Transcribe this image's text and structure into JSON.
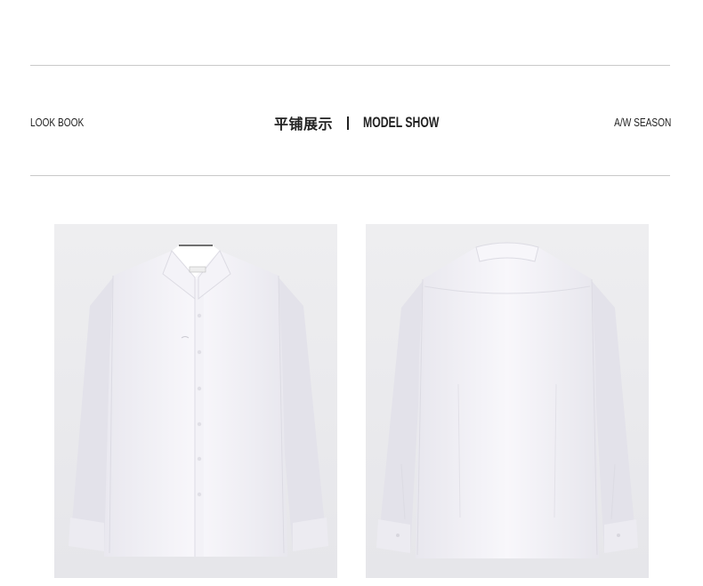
{
  "header": {
    "left_label": "LOOK BOOK",
    "center_cn": "平铺展示",
    "center_en": "MODEL SHOW",
    "right_label": "A/W SEASON"
  },
  "gallery": {
    "items": [
      {
        "view": "front",
        "icon": "shirt-front-image"
      },
      {
        "view": "back",
        "icon": "shirt-back-image"
      }
    ]
  },
  "colors": {
    "photo_bg": "#ececee",
    "shirt": "#f6f5f9",
    "shirt_shadow": "#dcdbe3",
    "rule": "#c9c9c9",
    "text": "#222222"
  }
}
